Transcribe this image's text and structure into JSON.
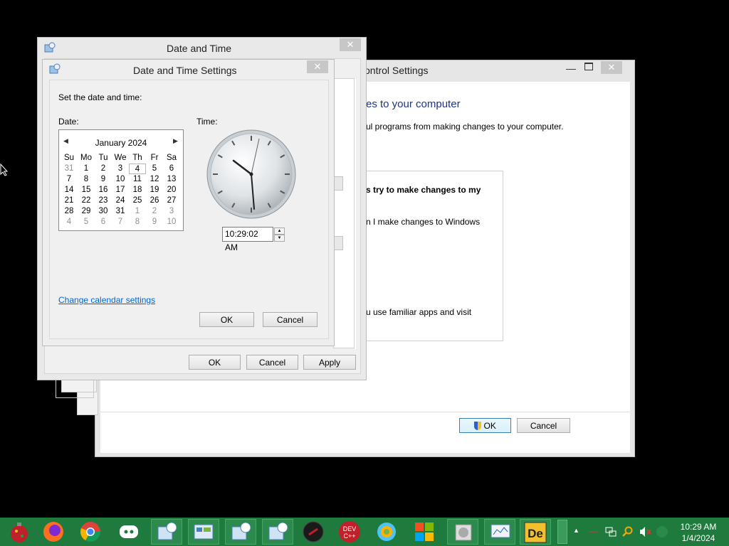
{
  "uac": {
    "title": "ontrol Settings",
    "heading": "es to your computer",
    "desc": "ul programs from making changes to your computer.",
    "option1": "s try to make changes to my",
    "option2": "n I make changes to Windows",
    "option3": "u use familiar apps and visit",
    "ok_label": "OK",
    "cancel_label": "Cancel"
  },
  "dt_window": {
    "title": "Date and Time",
    "ok_label": "OK",
    "cancel_label": "Cancel",
    "apply_label": "Apply"
  },
  "dts_dialog": {
    "title": "Date and Time Settings",
    "prompt": "Set the date and time:",
    "date_label": "Date:",
    "time_label": "Time:",
    "month": "January 2024",
    "weekdays": [
      "Su",
      "Mo",
      "Tu",
      "We",
      "Th",
      "Fr",
      "Sa"
    ],
    "weeks": [
      [
        "31",
        "1",
        "2",
        "3",
        "4",
        "5",
        "6"
      ],
      [
        "7",
        "8",
        "9",
        "10",
        "11",
        "12",
        "13"
      ],
      [
        "14",
        "15",
        "16",
        "17",
        "18",
        "19",
        "20"
      ],
      [
        "21",
        "22",
        "23",
        "24",
        "25",
        "26",
        "27"
      ],
      [
        "28",
        "29",
        "30",
        "31",
        "1",
        "2",
        "3"
      ],
      [
        "4",
        "5",
        "6",
        "7",
        "8",
        "9",
        "10"
      ]
    ],
    "time_value": "10:29:02 AM",
    "change_calendar_link": "Change calendar settings",
    "ok_label": "OK",
    "cancel_label": "Cancel"
  },
  "taskbar": {
    "clock_time": "10:29 AM",
    "clock_date": "1/4/2024",
    "icons": [
      "ornament-icon",
      "firefox-icon",
      "chrome-icon",
      "discord-icon",
      "datetime-icon",
      "control-panel-icon",
      "datetime-icon",
      "datetime-icon",
      "game-icon",
      "devcpp-icon",
      "photos-icon",
      "windows-icon",
      "disk-icon",
      "monitor-icon",
      "de-app-icon"
    ]
  },
  "colors": {
    "taskbar": "#1f7a3e",
    "link": "#0066cc",
    "heading": "#1e3287"
  }
}
